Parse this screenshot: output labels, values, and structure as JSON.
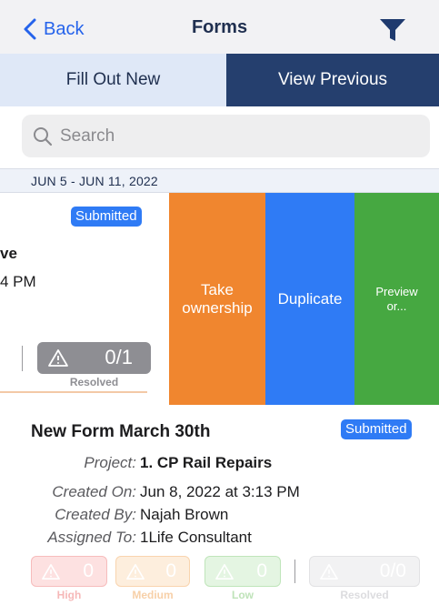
{
  "nav": {
    "back_label": "Back",
    "title": "Forms",
    "back_icon": "chevron-left-icon",
    "filter_icon": "filter-icon"
  },
  "tabs": [
    {
      "label": "Fill Out New",
      "selected": false
    },
    {
      "label": "View Previous",
      "selected": true
    }
  ],
  "search": {
    "placeholder": "Search",
    "value": ""
  },
  "section": {
    "date_range": "JUN 5 - JUN 11, 2022"
  },
  "swiped_row": {
    "status": "Submitted",
    "title_fragment": "ve",
    "time_fragment": "4 PM",
    "resolved": {
      "count": "0/1",
      "label": "Resolved"
    },
    "actions": {
      "take_ownership": "Take ownership",
      "duplicate": "Duplicate",
      "preview": "Preview or..."
    }
  },
  "form": {
    "title": "New Form March 30th",
    "status": "Submitted",
    "project_label": "Project:",
    "project_value": "1. CP Rail Repairs",
    "created_on_label": "Created On:",
    "created_on_value": "Jun 8, 2022 at 3:13 PM",
    "created_by_label": "Created By:",
    "created_by_value": "Najah Brown",
    "assigned_to_label": "Assigned To:",
    "assigned_to_value": "1Life Consultant",
    "severity": {
      "high": {
        "count": "0",
        "label": "High"
      },
      "medium": {
        "count": "0",
        "label": "Medium"
      },
      "low": {
        "count": "0",
        "label": "Low"
      },
      "resolved": {
        "count": "0/0",
        "label": "Resolved"
      }
    }
  },
  "colors": {
    "accent_blue": "#2f7bf5",
    "navy": "#253f6e",
    "orange": "#f0862f",
    "green": "#46a841"
  }
}
